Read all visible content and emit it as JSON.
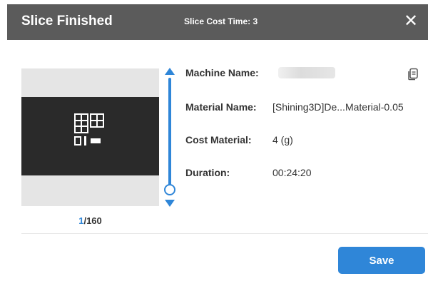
{
  "dialog": {
    "title": "Slice Finished",
    "subtitle": "Slice Cost Time: 3",
    "close_icon": "close-icon"
  },
  "preview": {
    "current_layer": "1",
    "layer_separator_total": "/160",
    "layer_current_value": 1,
    "layer_total_value": 160
  },
  "info": {
    "machine_label": "Machine Name:",
    "machine_value": "",
    "material_label": "Material Name:",
    "material_value": "[Shining3D]De...Material-0.05",
    "cost_label": "Cost Material:",
    "cost_value": "4 (g)",
    "duration_label": "Duration:",
    "duration_value": "00:24:20",
    "copy_icon": "copy-icon"
  },
  "actions": {
    "save_label": "Save"
  },
  "colors": {
    "titlebar": "#5b5b5b",
    "accent": "#2f86d8"
  }
}
